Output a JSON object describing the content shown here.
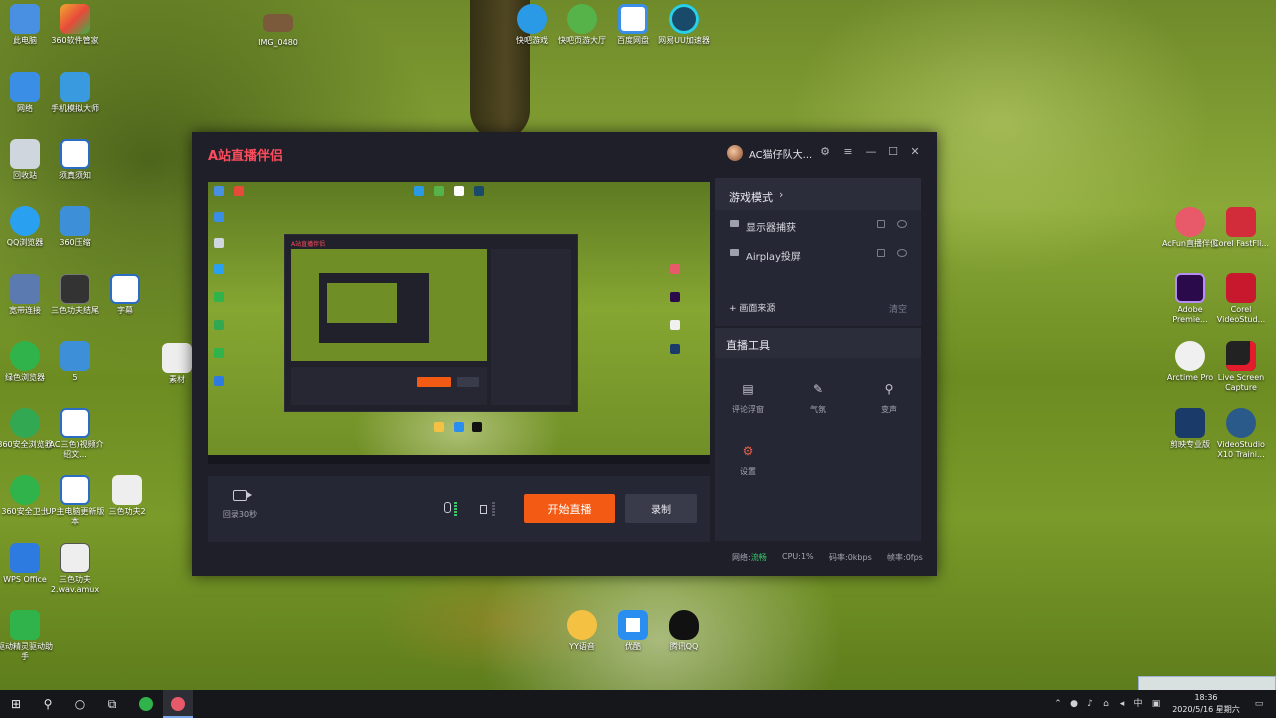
{
  "desktop": {
    "icons": [
      {
        "label": "此电脑",
        "icon": "computer-icon",
        "color": "#4a90e2"
      },
      {
        "label": "360软件管家",
        "icon": "360-software-icon",
        "color": "#f0a830"
      },
      {
        "label": "网络",
        "icon": "network-icon",
        "color": "#3a8ee6"
      },
      {
        "label": "手机模拟大师",
        "icon": "phone-emulator-icon",
        "color": "#3a9ae0"
      },
      {
        "label": "回收站",
        "icon": "recycle-bin-icon",
        "color": "#cfd6de"
      },
      {
        "label": "须真须知",
        "icon": "word-doc-icon",
        "color": "#2b6cc4"
      },
      {
        "label": "QQ浏览器",
        "icon": "qq-browser-icon",
        "color": "#2aa1f0"
      },
      {
        "label": "360压缩",
        "icon": "archive-icon",
        "color": "#3d8fd8"
      },
      {
        "label": "宽带连接",
        "icon": "broadband-icon",
        "color": "#5a7ab0"
      },
      {
        "label": "三色功夫结尾",
        "icon": "video-file-icon",
        "color": "#333"
      },
      {
        "label": "字幕",
        "icon": "word-doc-icon",
        "color": "#2b6cc4"
      },
      {
        "label": "绿色浏览器",
        "icon": "green-browser-icon",
        "color": "#2fb34a"
      },
      {
        "label": "5",
        "icon": "archive-icon",
        "color": "#3d8fd8"
      },
      {
        "label": "素材",
        "icon": "media-file-icon",
        "color": "#eeeeee"
      },
      {
        "label": "360安全浏览器",
        "icon": "360-browser-icon",
        "color": "#33a853"
      },
      {
        "label": "(AC三色)视频介绍文...",
        "icon": "word-doc-icon",
        "color": "#2b6cc4"
      },
      {
        "label": "360安全卫士",
        "icon": "360-security-icon",
        "color": "#2fb34a"
      },
      {
        "label": "UP主电脑更新版本",
        "icon": "word-doc-icon",
        "color": "#2b6cc4"
      },
      {
        "label": "三色功夫2",
        "icon": "media-file-icon",
        "color": "#eeeeee"
      },
      {
        "label": "WPS Office",
        "icon": "wps-icon",
        "color": "#2d7be0"
      },
      {
        "label": "三色功夫2.wav.amux",
        "icon": "video-file-icon",
        "color": "#eeeeee"
      },
      {
        "label": "驱动精灵驱动助手",
        "icon": "driver-gear-icon",
        "color": "#2fb34a"
      },
      {
        "label": "IMG_0480",
        "icon": "image-file-icon",
        "color": "#7a5a3a"
      },
      {
        "label": "快吧游戏",
        "icon": "kuaiba-game-icon",
        "color": "#2a9ae6"
      },
      {
        "label": "快吧页游大厅",
        "icon": "kuaiba-hall-icon",
        "color": "#55b34a"
      },
      {
        "label": "百度网盘",
        "icon": "baidu-cloud-icon",
        "color": "#3a8ee6"
      },
      {
        "label": "网易UU加速器",
        "icon": "uu-accelerator-icon",
        "color": "#1a4a6a"
      },
      {
        "label": "YY语音",
        "icon": "yy-voice-icon",
        "color": "#f5c142"
      },
      {
        "label": "优酷",
        "icon": "youku-icon",
        "color": "#2a8ef0"
      },
      {
        "label": "腾讯QQ",
        "icon": "qq-icon",
        "color": "#111111"
      },
      {
        "label": "AcFun直播伴侣",
        "icon": "acfun-live-icon",
        "color": "#e85a6a"
      },
      {
        "label": "Corel FastFli...",
        "icon": "corel-fastflick-icon",
        "color": "#d22c3a"
      },
      {
        "label": "Adobe Premie...",
        "icon": "premiere-icon",
        "color": "#2a0a4a"
      },
      {
        "label": "Corel VideoStud...",
        "icon": "corel-videostudio-icon",
        "color": "#c8182e"
      },
      {
        "label": "Arctime Pro",
        "icon": "arctime-icon",
        "color": "#f0f0f0"
      },
      {
        "label": "Live Screen Capture",
        "icon": "screen-capture-icon",
        "color": "#222222"
      },
      {
        "label": "剪映专业版",
        "icon": "editor-icon",
        "color": "#1a3a6a"
      },
      {
        "label": "VideoStudio X10 Traini...",
        "icon": "videostudio-sd-icon",
        "color": "#2a5a8a"
      }
    ]
  },
  "app": {
    "title": "A站直播伴侣",
    "username": "AC猫仔队大...",
    "window_buttons": {
      "settings": "⚙",
      "menu": "≡",
      "minimize": "—",
      "maximize": "☐",
      "close": "✕"
    },
    "preview_window_title": "A站直播伴侣",
    "replay_label": "回录30秒",
    "start_button": "开始直播",
    "record_button": "录制",
    "mode_title": "游戏模式",
    "sources": [
      {
        "label": "显示器捕获"
      },
      {
        "label": "Airplay投屏"
      }
    ],
    "add_source": "+ 画面来源",
    "clear": "清空",
    "tools_title": "直播工具",
    "tools": [
      {
        "label": "评论浮窗",
        "icon": "comment-window-icon",
        "glyph": "▤"
      },
      {
        "label": "气氛",
        "icon": "atmosphere-icon",
        "glyph": "✎"
      },
      {
        "label": "变声",
        "icon": "voice-change-icon",
        "glyph": "⚲"
      },
      {
        "label": "设置",
        "icon": "settings-gear-icon",
        "glyph": "⚙"
      }
    ],
    "status": {
      "network_label": "网络:",
      "network_value": "流畅",
      "cpu": "CPU:1%",
      "bitrate": "码率:0kbps",
      "framerate": "帧率:0fps"
    }
  },
  "taskbar": {
    "time": "18:36",
    "date": "2020/5/16 星期六",
    "ime": "中"
  }
}
